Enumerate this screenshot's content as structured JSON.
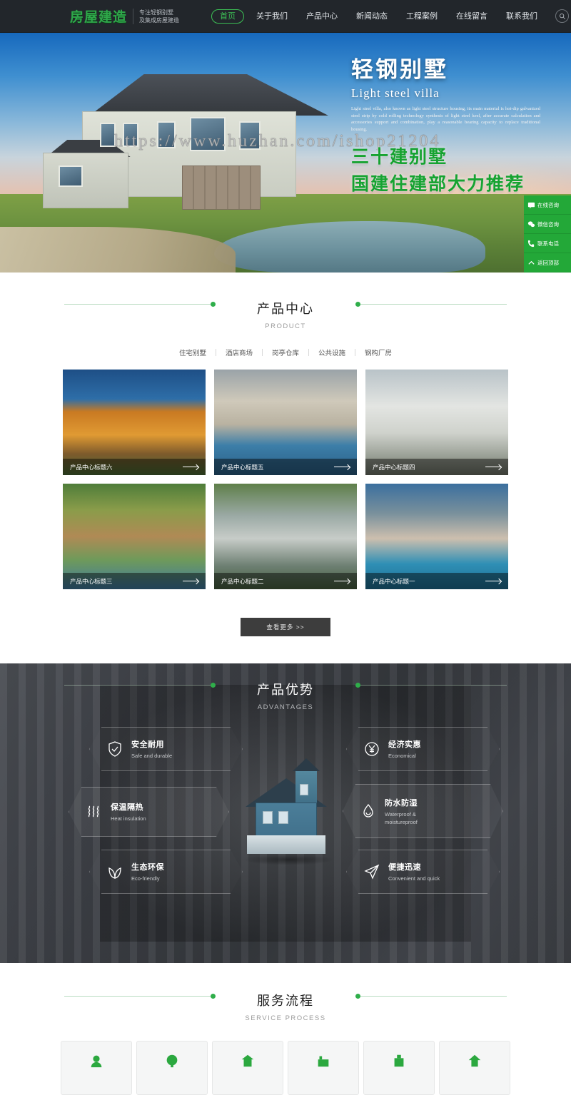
{
  "header": {
    "logo_text": "房屋建造",
    "tagline_line1": "专注轻钢别墅",
    "tagline_line2": "及集成房屋建造",
    "nav": [
      {
        "label": "首页",
        "active": true
      },
      {
        "label": "关于我们",
        "active": false
      },
      {
        "label": "产品中心",
        "active": false
      },
      {
        "label": "新闻动态",
        "active": false
      },
      {
        "label": "工程案例",
        "active": false
      },
      {
        "label": "在线留言",
        "active": false
      },
      {
        "label": "联系我们",
        "active": false
      }
    ],
    "search_icon": "search-icon"
  },
  "hero": {
    "title": "轻钢别墅",
    "subtitle": "Light steel villa",
    "description": "Light steel villa, also known as light steel structure housing, its main material is hot-dip galvanized steel strip by cold rolling technology synthesis of light steel keel, after accurate calculation and accessories support and combination, play a reasonable bearing capacity to replace traditional housing.",
    "green_line1": "三十建别墅",
    "green_line2": "国建住建部大力推荐",
    "watermark": "https://www.huzhan.com/ishop21204"
  },
  "side_panel": {
    "items": [
      {
        "label": "在线咨询",
        "icon": "chat-icon"
      },
      {
        "label": "微信咨询",
        "icon": "wechat-icon"
      },
      {
        "label": "联系电话",
        "icon": "phone-icon"
      },
      {
        "label": "返回顶部",
        "icon": "chevron-up-icon"
      }
    ]
  },
  "product": {
    "title": "产品中心",
    "subtitle": "PRODUCT",
    "tabs": [
      "住宅别墅",
      "酒店商场",
      "岗亭仓库",
      "公共设施",
      "钢构厂房"
    ],
    "cards": [
      {
        "caption": "产品中心标题六"
      },
      {
        "caption": "产品中心标题五"
      },
      {
        "caption": "产品中心标题四"
      },
      {
        "caption": "产品中心标题三"
      },
      {
        "caption": "产品中心标题二"
      },
      {
        "caption": "产品中心标题一"
      }
    ],
    "more_label": "查看更多 >>"
  },
  "advantages": {
    "title": "产品优势",
    "subtitle": "ADVANTAGES",
    "left_items": [
      {
        "zh": "安全耐用",
        "en": "Safe and durable",
        "icon": "shield-check-icon"
      },
      {
        "zh": "保温隔热",
        "en": "Heat insulation",
        "icon": "heat-waves-icon"
      },
      {
        "zh": "生态环保",
        "en": "Eco-friendly",
        "icon": "leaf-icon"
      }
    ],
    "right_items": [
      {
        "zh": "经济实惠",
        "en": "Economical",
        "icon": "yuan-coin-icon"
      },
      {
        "zh": "防水防湿",
        "en": "Waterproof &\nmoistureproof",
        "icon": "water-drop-icon"
      },
      {
        "zh": "便捷迅速",
        "en": "Convenient and quick",
        "icon": "paper-plane-icon"
      }
    ]
  },
  "service": {
    "title": "服务流程",
    "subtitle": "SERVICE PROCESS",
    "cards": [
      {
        "icon": "consult-icon"
      },
      {
        "icon": "design-icon"
      },
      {
        "icon": "contract-icon"
      },
      {
        "icon": "produce-icon"
      },
      {
        "icon": "build-icon"
      },
      {
        "icon": "handover-icon"
      }
    ]
  },
  "colors": {
    "green": "#2fae4a",
    "header_bg": "#22262b",
    "dark_section": "#3a3d42"
  }
}
